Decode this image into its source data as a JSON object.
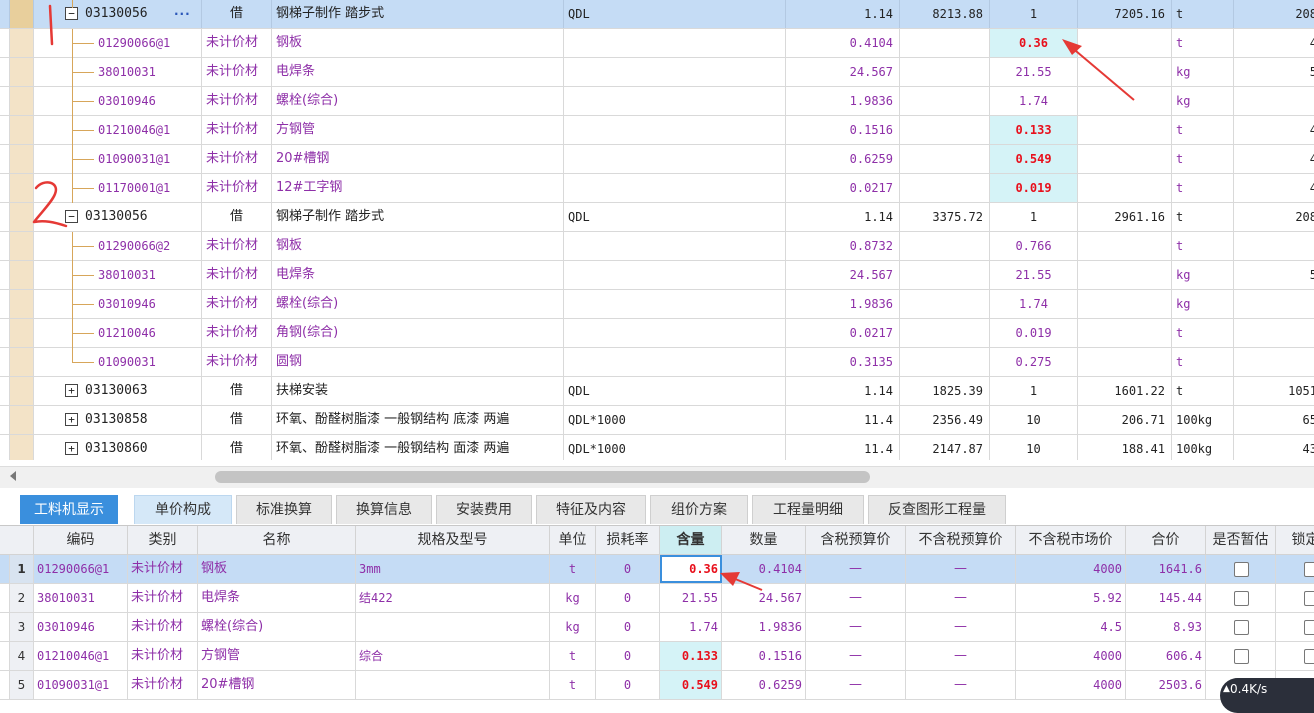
{
  "top_grid": {
    "rows": [
      {
        "kind": "parent",
        "expander": "−",
        "code": "03130056",
        "ellipsis": "···",
        "type": "借",
        "name": "钢梯子制作 踏步式",
        "expr": "QDL",
        "qty": "1.14",
        "price": "8213.88",
        "content": "1",
        "unitprice": "7205.16",
        "unit": "t",
        "total": "208",
        "selected": true
      },
      {
        "kind": "child",
        "code": "01290066@1",
        "type": "未计价材",
        "name": "钢板",
        "expr": "",
        "qty": "0.4104",
        "price": "",
        "content": "0.36",
        "content_hl": true,
        "unitprice": "",
        "unit": "t",
        "total": "4"
      },
      {
        "kind": "child",
        "code": "38010031",
        "type": "未计价材",
        "name": "电焊条",
        "expr": "",
        "qty": "24.567",
        "price": "",
        "content": "21.55",
        "content_hl": false,
        "unitprice": "",
        "unit": "kg",
        "total": "5"
      },
      {
        "kind": "child",
        "code": "03010946",
        "type": "未计价材",
        "name": "螺栓(综合)",
        "expr": "",
        "qty": "1.9836",
        "price": "",
        "content": "1.74",
        "content_hl": false,
        "unitprice": "",
        "unit": "kg",
        "total": ""
      },
      {
        "kind": "child",
        "code": "01210046@1",
        "type": "未计价材",
        "name": "方钢管",
        "expr": "",
        "qty": "0.1516",
        "price": "",
        "content": "0.133",
        "content_hl": true,
        "unitprice": "",
        "unit": "t",
        "total": "4"
      },
      {
        "kind": "child",
        "code": "01090031@1",
        "type": "未计价材",
        "name": "20#槽钢",
        "expr": "",
        "qty": "0.6259",
        "price": "",
        "content": "0.549",
        "content_hl": true,
        "unitprice": "",
        "unit": "t",
        "total": "4"
      },
      {
        "kind": "child",
        "code": "01170001@1",
        "type": "未计价材",
        "name": "12#工字钢",
        "expr": "",
        "qty": "0.0217",
        "price": "",
        "content": "0.019",
        "content_hl": true,
        "unitprice": "",
        "unit": "t",
        "total": "4"
      },
      {
        "kind": "parent",
        "expander": "−",
        "code": "03130056",
        "ellipsis": "",
        "type": "借",
        "name": "钢梯子制作 踏步式",
        "expr": "QDL",
        "qty": "1.14",
        "price": "3375.72",
        "content": "1",
        "unitprice": "2961.16",
        "unit": "t",
        "total": "208",
        "selected": false
      },
      {
        "kind": "child",
        "code": "01290066@2",
        "type": "未计价材",
        "name": "钢板",
        "expr": "",
        "qty": "0.8732",
        "price": "",
        "content": "0.766",
        "content_hl": false,
        "unitprice": "",
        "unit": "t",
        "total": ""
      },
      {
        "kind": "child",
        "code": "38010031",
        "type": "未计价材",
        "name": "电焊条",
        "expr": "",
        "qty": "24.567",
        "price": "",
        "content": "21.55",
        "content_hl": false,
        "unitprice": "",
        "unit": "kg",
        "total": "5"
      },
      {
        "kind": "child",
        "code": "03010946",
        "type": "未计价材",
        "name": "螺栓(综合)",
        "expr": "",
        "qty": "1.9836",
        "price": "",
        "content": "1.74",
        "content_hl": false,
        "unitprice": "",
        "unit": "kg",
        "total": ""
      },
      {
        "kind": "child",
        "code": "01210046",
        "type": "未计价材",
        "name": "角钢(综合)",
        "expr": "",
        "qty": "0.0217",
        "price": "",
        "content": "0.019",
        "content_hl": false,
        "unitprice": "",
        "unit": "t",
        "total": ""
      },
      {
        "kind": "child",
        "code": "01090031",
        "type": "未计价材",
        "name": "圆钢",
        "expr": "",
        "qty": "0.3135",
        "price": "",
        "content": "0.275",
        "content_hl": false,
        "unitprice": "",
        "unit": "t",
        "total": ""
      },
      {
        "kind": "parent",
        "expander": "+",
        "code": "03130063",
        "ellipsis": "",
        "type": "借",
        "name": "扶梯安装",
        "expr": "QDL",
        "qty": "1.14",
        "price": "1825.39",
        "content": "1",
        "unitprice": "1601.22",
        "unit": "t",
        "total": "1051",
        "selected": false
      },
      {
        "kind": "parent",
        "expander": "+",
        "code": "03130858",
        "ellipsis": "",
        "type": "借",
        "name": "环氧、酚醛树脂漆 一般钢结构 底漆 两遍",
        "expr": "QDL*1000",
        "qty": "11.4",
        "price": "2356.49",
        "content": "10",
        "unitprice": "206.71",
        "unit": "100kg",
        "total": "65",
        "selected": false
      },
      {
        "kind": "parent",
        "expander": "+",
        "code": "03130860",
        "ellipsis": "",
        "type": "借",
        "name": "环氧、酚醛树脂漆 一般钢结构 面漆 两遍",
        "expr": "QDL*1000",
        "qty": "11.4",
        "price": "2147.87",
        "content": "10",
        "unitprice": "188.41",
        "unit": "100kg",
        "total": "43",
        "selected": false
      }
    ]
  },
  "tabs": [
    "工料机显示",
    "单价构成",
    "标准换算",
    "换算信息",
    "安装费用",
    "特征及内容",
    "组价方案",
    "工程量明细",
    "反查图形工程量"
  ],
  "bottom_grid": {
    "headers": [
      "编码",
      "类别",
      "名称",
      "规格及型号",
      "单位",
      "损耗率",
      "含量",
      "数量",
      "含税预算价",
      "不含税预算价",
      "不含税市场价",
      "合价",
      "是否暂估",
      "锁定"
    ],
    "rows": [
      {
        "no": "1",
        "code": "01290066@1",
        "type": "未计价材",
        "name": "钢板",
        "spec": "3mm",
        "unit": "t",
        "loss": "0",
        "content": "0.36",
        "hl": true,
        "qty": "0.4104",
        "p1": "—",
        "p2": "—",
        "market": "4000",
        "total": "1641.6",
        "selected": true
      },
      {
        "no": "2",
        "code": "38010031",
        "type": "未计价材",
        "name": "电焊条",
        "spec": "结422",
        "unit": "kg",
        "loss": "0",
        "content": "21.55",
        "hl": false,
        "qty": "24.567",
        "p1": "—",
        "p2": "—",
        "market": "5.92",
        "total": "145.44",
        "selected": false
      },
      {
        "no": "3",
        "code": "03010946",
        "type": "未计价材",
        "name": "螺栓(综合)",
        "spec": "",
        "unit": "kg",
        "loss": "0",
        "content": "1.74",
        "hl": false,
        "qty": "1.9836",
        "p1": "—",
        "p2": "—",
        "market": "4.5",
        "total": "8.93",
        "selected": false
      },
      {
        "no": "4",
        "code": "01210046@1",
        "type": "未计价材",
        "name": "方钢管",
        "spec": "综合",
        "unit": "t",
        "loss": "0",
        "content": "0.133",
        "hl": true,
        "qty": "0.1516",
        "p1": "—",
        "p2": "—",
        "market": "4000",
        "total": "606.4",
        "selected": false
      },
      {
        "no": "5",
        "code": "01090031@1",
        "type": "未计价材",
        "name": "20#槽钢",
        "spec": "",
        "unit": "t",
        "loss": "0",
        "content": "0.549",
        "hl": true,
        "qty": "0.6259",
        "p1": "—",
        "p2": "—",
        "market": "4000",
        "total": "2503.6",
        "selected": false
      }
    ]
  },
  "annotations": {
    "mark1": "1",
    "mark2": "2"
  },
  "speed": {
    "arrow": "▲",
    "value": "0.4K/s"
  },
  "colors": {
    "accent": "#3a8fdd",
    "selected_row": "#c5dcf5",
    "material_text": "#8e2fa8",
    "highlight_red": "#e8101c",
    "highlight_cell": "#d5f3f7",
    "annotation_red": "#e53935"
  }
}
